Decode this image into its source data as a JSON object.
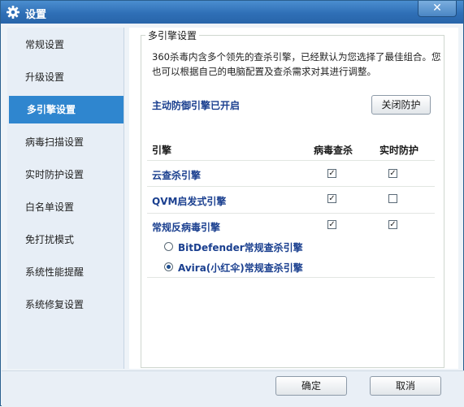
{
  "window": {
    "title": "设置",
    "close_glyph": "✕",
    "icons": {
      "title": "gear-icon",
      "close": "close-icon"
    }
  },
  "sidebar": {
    "items": [
      {
        "label": "常规设置",
        "active": false
      },
      {
        "label": "升级设置",
        "active": false
      },
      {
        "label": "多引擎设置",
        "active": true
      },
      {
        "label": "病毒扫描设置",
        "active": false
      },
      {
        "label": "实时防护设置",
        "active": false
      },
      {
        "label": "白名单设置",
        "active": false
      },
      {
        "label": "免打扰模式",
        "active": false
      },
      {
        "label": "系统性能提醒",
        "active": false
      },
      {
        "label": "系统修复设置",
        "active": false
      }
    ]
  },
  "main": {
    "group_title": "多引擎设置",
    "description": "360杀毒内含多个领先的查杀引擎，已经默认为您选择了最佳组合。您也可以根据自己的电脑配置及查杀需求对其进行调整。",
    "status": "主动防御引擎已开启",
    "protect_button": "关闭防护",
    "columns": {
      "engine": "引擎",
      "scan": "病毒查杀",
      "realtime": "实时防护"
    },
    "engines": [
      {
        "name": "云查杀引擎",
        "scan": true,
        "realtime": true
      },
      {
        "name": "QVM启发式引擎",
        "scan": true,
        "realtime": false
      },
      {
        "name": "常规反病毒引擎",
        "scan": true,
        "realtime": true
      }
    ],
    "subengines": [
      {
        "label": "BitDefender常规查杀引擎",
        "selected": false
      },
      {
        "label": "Avira(小红伞)常规查杀引擎",
        "selected": true
      }
    ],
    "check_glyph": "✓"
  },
  "footer": {
    "ok": "确定",
    "cancel": "取消"
  },
  "colors": {
    "titlebar": "#2f6fb6",
    "accent": "#2f86cf",
    "link_text": "#1a3f8f"
  }
}
